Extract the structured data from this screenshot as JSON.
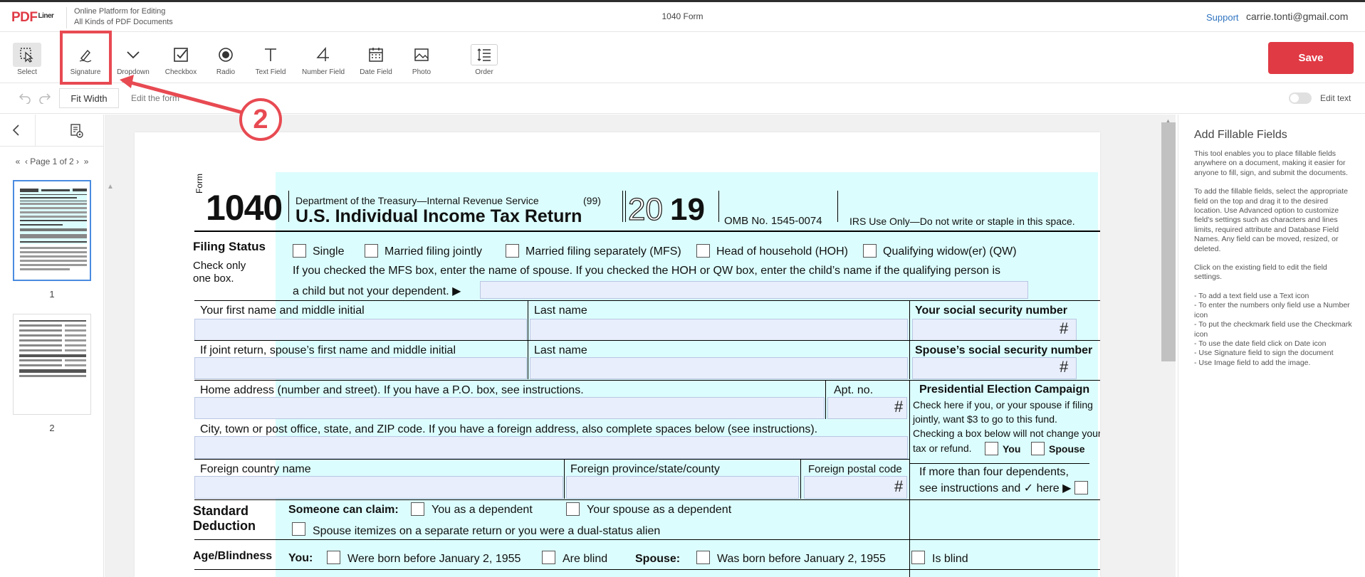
{
  "header": {
    "logo_pdf": "PDF",
    "logo_liner": "Liner",
    "tagline_line1": "Online Platform for Editing",
    "tagline_line2": "All Kinds of PDF Documents",
    "doc_title": "1040 Form",
    "support_link": "Support",
    "user_email": "carrie.tonti@gmail.com"
  },
  "toolbar": {
    "tools": [
      {
        "label": "Select",
        "icon": "cursor-select-icon"
      },
      {
        "label": "Signature",
        "icon": "pen-signature-icon"
      },
      {
        "label": "Dropdown",
        "icon": "chevron-down-icon"
      },
      {
        "label": "Checkbox",
        "icon": "checkbox-icon"
      },
      {
        "label": "Radio",
        "icon": "radio-icon"
      },
      {
        "label": "Text Field",
        "icon": "text-t-icon"
      },
      {
        "label": "Number Field",
        "icon": "number-4-icon"
      },
      {
        "label": "Date Field",
        "icon": "calendar-icon"
      },
      {
        "label": "Photo",
        "icon": "image-icon"
      },
      {
        "label": "Order",
        "icon": "order-icon"
      }
    ],
    "save_label": "Save"
  },
  "subbar": {
    "zoom_value": "Fit Width",
    "mode_label": "Edit the form",
    "edit_text_label": "Edit text",
    "edit_text_on": false
  },
  "sidebar": {
    "pager_text": "Page 1 of 2",
    "pages": [
      "1",
      "2"
    ],
    "selected_page": 1
  },
  "annotation": {
    "step_number": "2",
    "color": "#e84a52"
  },
  "right_panel": {
    "title": "Add Fillable Fields",
    "para1": "This tool enables you to place fillable fields anywhere on a document, making it easier for anyone to fill, sign, and submit the documents.",
    "para2": "To add the fillable fields, select the appropriate field on the top and drag it to the desired location. Use Advanced option to customize field's settings such as characters and lines limits, required attribute and Database Field Names. Any field can be moved, resized, or deleted.",
    "para3": "Click on the existing field to edit the field settings.",
    "tips": [
      "- To add a text field use a Text icon",
      "- To enter the numbers only field use a Number icon",
      "- To put the checkmark field use the Checkmark icon",
      "- To use the date field click on Date icon",
      "- Use Signature field to sign the document",
      "- Use Image field to add the image."
    ]
  },
  "form": {
    "form_word": "Form",
    "form_number": "1040",
    "dept": "Department of the Treasury—Internal Revenue Service",
    "code99": "(99)",
    "main_title": "U.S. Individual Income Tax Return",
    "year_outline": "20",
    "year_bold": "19",
    "omb": "OMB No. 1545-0074",
    "irs_only": "IRS Use Only—Do not write or staple in this space.",
    "filing_status": "Filing Status",
    "check_only": "Check only",
    "one_box": "one box.",
    "fs_options": [
      "Single",
      "Married filing jointly",
      "Married filing separately (MFS)",
      "Head of household (HOH)",
      "Qualifying widow(er) (QW)"
    ],
    "mfs_line1": "If you checked the MFS box, enter the name of spouse. If you checked the HOH or QW box, enter the child’s name if the qualifying person is",
    "mfs_line2": "a child but not your dependent. ▶",
    "first_name": "Your first name and middle initial",
    "last_name": "Last name",
    "ssn": "Your social security number",
    "spouse_first": "If joint return, spouse’s first name and middle initial",
    "spouse_last": "Last name",
    "spouse_ssn": "Spouse’s social security number",
    "home_address": "Home address (number and street). If you have a P.O. box, see instructions.",
    "apt": "Apt. no.",
    "pec_title": "Presidential Election Campaign",
    "pec_l1": "Check here if you, or your spouse if filing",
    "pec_l2": "jointly, want $3 to go to this fund.",
    "pec_l3": "Checking a box below will not change your",
    "pec_l4": "tax or refund.",
    "pec_you": "You",
    "pec_spouse": "Spouse",
    "city": "City, town or post office, state, and ZIP code. If you have a foreign address, also complete spaces below (see instructions).",
    "foreign_country": "Foreign country name",
    "foreign_province": "Foreign province/state/county",
    "foreign_postal": "Foreign postal code",
    "more_dep_l1": "If more than four dependents,",
    "more_dep_l2": "see instructions and ✓ here ▶",
    "std_ded_l1": "Standard",
    "std_ded_l2": "Deduction",
    "someone_claim": "Someone can claim:",
    "you_dependent": "You as a dependent",
    "spouse_dependent": "Your spouse as a dependent",
    "spouse_itemizes": "Spouse itemizes on a separate return or you were a dual-status alien",
    "age_blind": "Age/Blindness",
    "you_label": "You:",
    "born_before": "Were born before January 2, 1955",
    "are_blind": "Are blind",
    "spouse_label": "Spouse:",
    "spouse_born": "Was born before January 2, 1955",
    "is_blind": "Is blind",
    "hash": "#"
  }
}
